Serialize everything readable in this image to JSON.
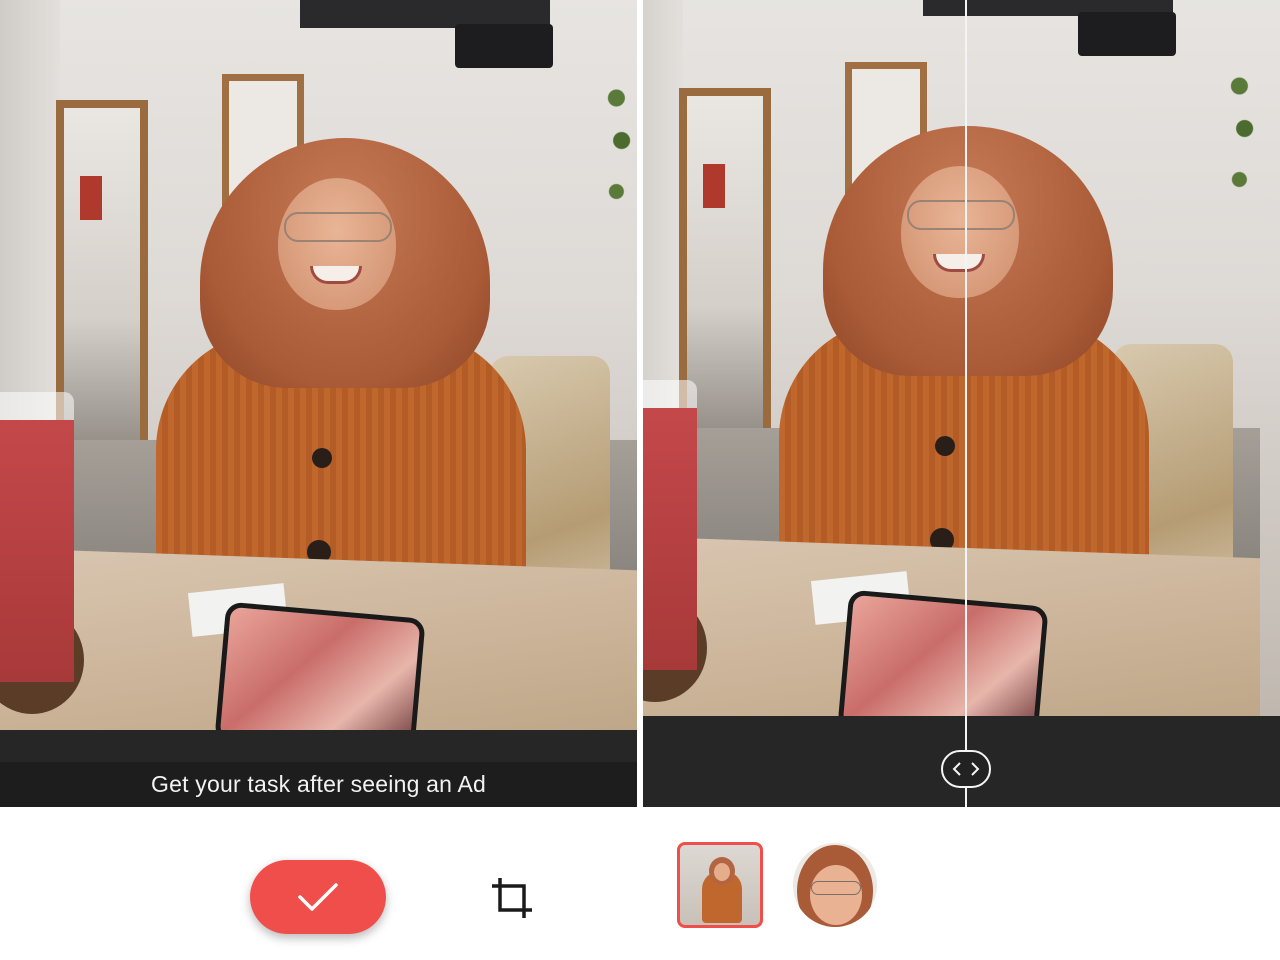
{
  "left_panel": {
    "ad_banner_text": "Get your task after seeing an Ad",
    "confirm_icon": "check-icon",
    "crop_icon": "crop-icon"
  },
  "right_panel": {
    "compare_handle_icon": "left-right-arrows-icon",
    "thumbnails": [
      {
        "name": "full-photo-thumbnail",
        "selected": true
      },
      {
        "name": "face-crop-thumbnail",
        "selected": false
      }
    ]
  },
  "colors": {
    "accent": "#ef4e4a",
    "dark_bar": "#262626",
    "ad_banner_bg": "#1d1d1d",
    "background": "#ffffff"
  }
}
